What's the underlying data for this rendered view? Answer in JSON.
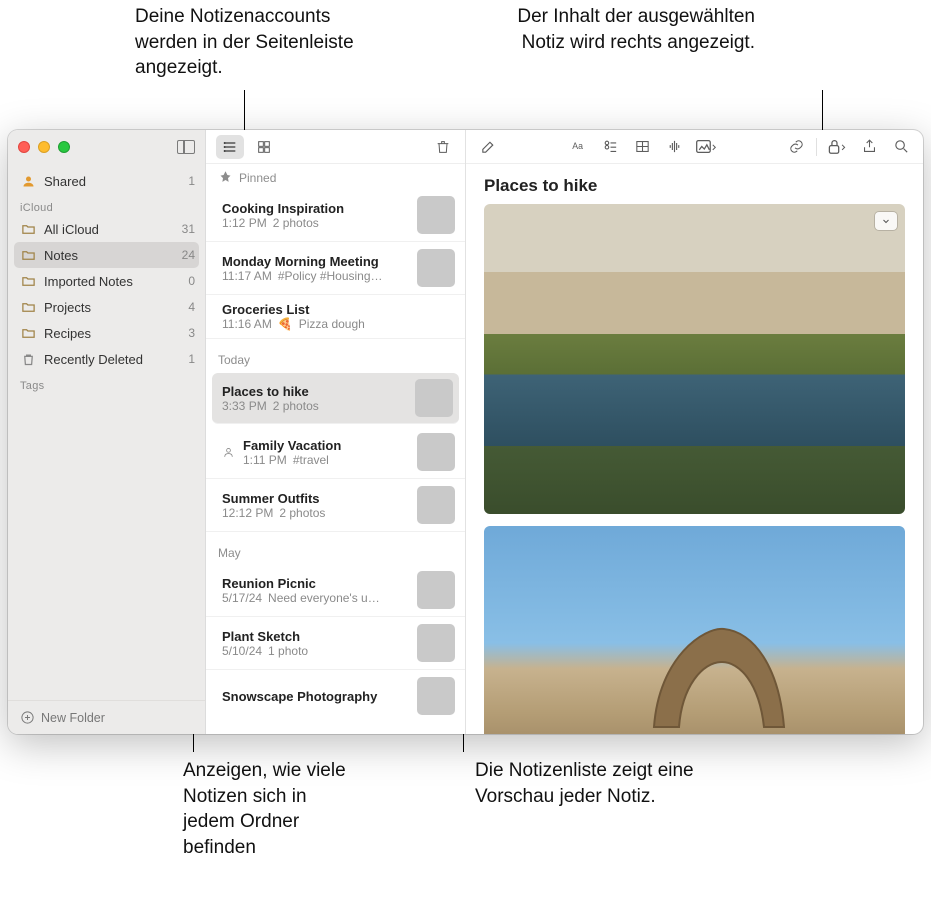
{
  "callouts": {
    "top_left": "Deine Notizenaccounts werden in der Seitenleiste angezeigt.",
    "top_right": "Der Inhalt der ausgewählten Notiz wird rechts angezeigt.",
    "bottom_left": "Anzeigen, wie viele Notizen sich in jedem Ordner befinden",
    "bottom_right": "Die Notizenliste zeigt eine Vorschau jeder Notiz."
  },
  "sidebar": {
    "shared_label": "Shared",
    "shared_count": "1",
    "section_icloud": "iCloud",
    "section_tags": "Tags",
    "items": [
      {
        "label": "All iCloud",
        "count": "31"
      },
      {
        "label": "Notes",
        "count": "24"
      },
      {
        "label": "Imported Notes",
        "count": "0"
      },
      {
        "label": "Projects",
        "count": "4"
      },
      {
        "label": "Recipes",
        "count": "3"
      },
      {
        "label": "Recently Deleted",
        "count": "1"
      }
    ],
    "new_folder_label": "New Folder"
  },
  "noteslist": {
    "section_pinned": "Pinned",
    "section_today": "Today",
    "section_may": "May",
    "pinned": [
      {
        "title": "Cooking Inspiration",
        "time": "1:12 PM",
        "preview": "2 photos"
      },
      {
        "title": "Monday Morning Meeting",
        "time": "11:17 AM",
        "preview": "#Policy #Housing…"
      },
      {
        "title": "Groceries List",
        "time": "11:16 AM",
        "preview": "Pizza dough",
        "emoji": "🍕"
      }
    ],
    "today": [
      {
        "title": "Places to hike",
        "time": "3:33 PM",
        "preview": "2 photos"
      },
      {
        "title": "Family Vacation",
        "time": "1:11 PM",
        "preview": "#travel",
        "shared": true
      },
      {
        "title": "Summer Outfits",
        "time": "12:12 PM",
        "preview": "2 photos"
      }
    ],
    "may": [
      {
        "title": "Reunion Picnic",
        "time": "5/17/24",
        "preview": "Need everyone's u…"
      },
      {
        "title": "Plant Sketch",
        "time": "5/10/24",
        "preview": "1 photo"
      },
      {
        "title": "Snowscape Photography",
        "time": "",
        "preview": ""
      }
    ]
  },
  "content": {
    "title": "Places to hike"
  }
}
